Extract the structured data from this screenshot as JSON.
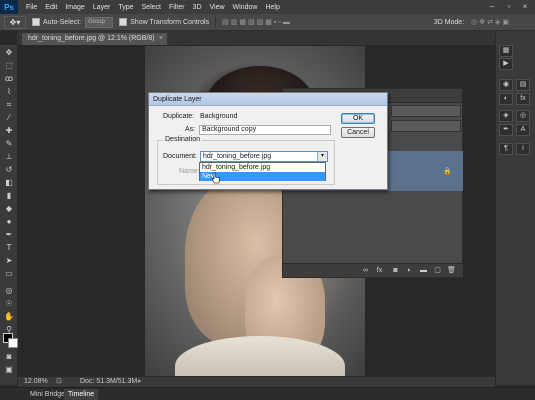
{
  "app": {
    "logo": "Ps",
    "menus": [
      "File",
      "Edit",
      "Image",
      "Layer",
      "Type",
      "Select",
      "Filter",
      "3D",
      "View",
      "Window",
      "Help"
    ]
  },
  "options": {
    "auto_select_label": "Auto-Select:",
    "auto_select_value": "Group",
    "show_transform_label": "Show Transform Controls",
    "mode_3d_label": "3D Mode:"
  },
  "document": {
    "tab_title": "hdr_toning_before.jpg @ 12.1% (RGB/8)",
    "close_glyph": "×"
  },
  "dialog": {
    "title": "Duplicate Layer",
    "duplicate_label": "Duplicate:",
    "duplicate_value": "Background",
    "as_label": "As:",
    "as_value": "Background copy",
    "destination_label": "Destination",
    "document_label": "Document:",
    "document_value": "hdr_toning_before.jpg",
    "name_label": "Name:",
    "ok_label": "OK",
    "cancel_label": "Cancel",
    "dropdown_options": [
      "hdr_toning_before.jpg",
      "New"
    ],
    "dropdown_selected": "New"
  },
  "status": {
    "zoom": "12.08%",
    "doc_size": "Doc: 51.3M/51.3M"
  },
  "bottom_tabs": [
    "Mini Bridge",
    "Timeline"
  ],
  "active_bottom_tab": "Timeline"
}
